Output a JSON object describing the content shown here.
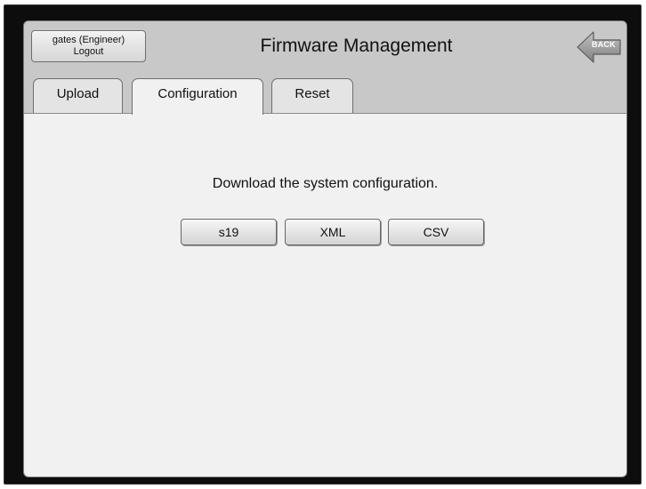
{
  "header": {
    "user_line1": "gates (Engineer)",
    "user_line2": "Logout",
    "title": "Firmware Management",
    "back_label": "BACK"
  },
  "tabs": [
    {
      "label": "Upload",
      "active": false
    },
    {
      "label": "Configuration",
      "active": true
    },
    {
      "label": "Reset",
      "active": false
    }
  ],
  "content": {
    "message": "Download the system configuration.",
    "buttons": [
      {
        "label": "s19"
      },
      {
        "label": "XML"
      },
      {
        "label": "CSV"
      }
    ]
  },
  "colors": {
    "frame": "#0d0d0d",
    "header": "#c8c8c8",
    "panel": "#f1f1f1",
    "back_arrow": "#9a9a9a"
  },
  "icons": {
    "back": "back-arrow-icon"
  }
}
